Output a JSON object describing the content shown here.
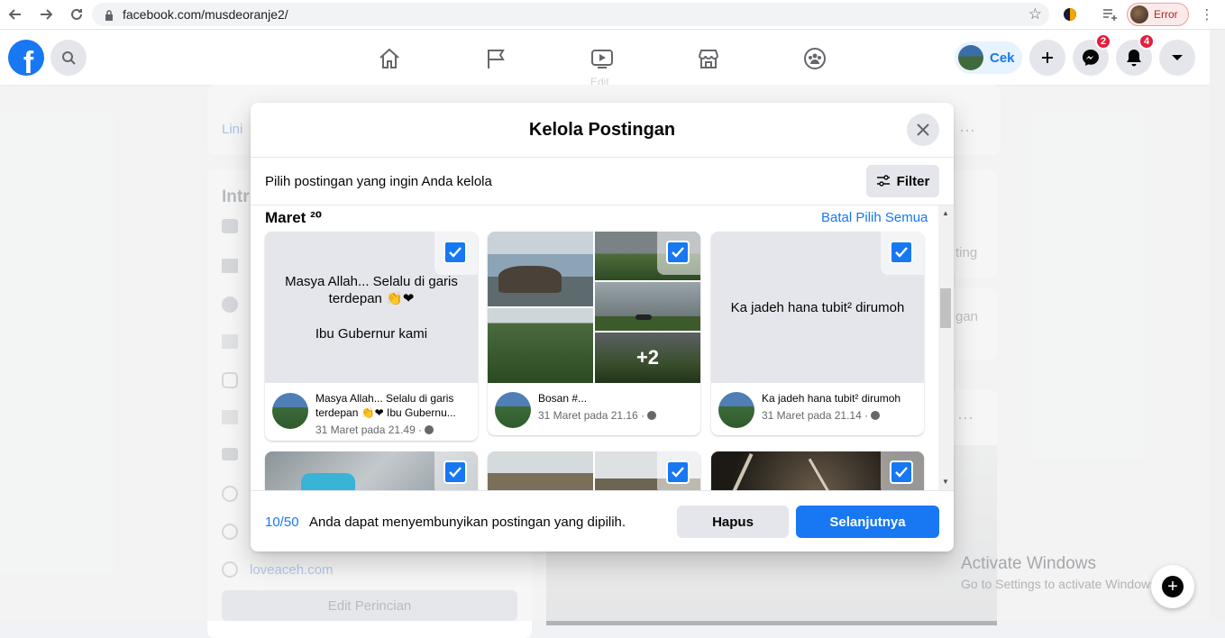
{
  "browser": {
    "url": "facebook.com/musdeoranje2/",
    "profile_status": "Error"
  },
  "topnav": {
    "cek_label": "Cek",
    "messenger_badge": "2",
    "notif_badge": "4",
    "edit_text": "Edit"
  },
  "background": {
    "tab_label": "Lini",
    "intro_label": "Intr",
    "setting_text": "ting",
    "gan_text": "gan",
    "website": "loveaceh.com",
    "edit_btn": "Edit Perincian",
    "windows_title": "Activate Windows",
    "windows_sub": "Go to Settings to activate Windows."
  },
  "modal": {
    "title": "Kelola Postingan",
    "subtitle": "Pilih postingan yang ingin Anda kelola",
    "filter_label": "Filter",
    "month_label": "Maret ²⁰",
    "deselect_all": "Batal Pilih Semua",
    "posts": [
      {
        "preview_line1": "Masya Allah... Selalu di garis terdepan 👏❤",
        "preview_line2": "Ibu Gubernur kami",
        "title": "Masya Allah... Selalu di garis terdepan 👏❤ Ibu Gubernu...",
        "time": "31 Maret pada 21.49 ·"
      },
      {
        "more_count": "+2",
        "title": "Bosan #...",
        "time": "31 Maret pada 21.16 ·"
      },
      {
        "preview_line1": "Ka jadeh hana tubit² dirumoh",
        "title": "Ka jadeh hana tubit² dirumoh",
        "time": "31 Maret pada 21.14 ·"
      }
    ],
    "selected_count": "10/50",
    "footer_hint": "Anda dapat menyembunyikan postingan yang dipilih.",
    "delete_label": "Hapus",
    "next_label": "Selanjutnya"
  }
}
